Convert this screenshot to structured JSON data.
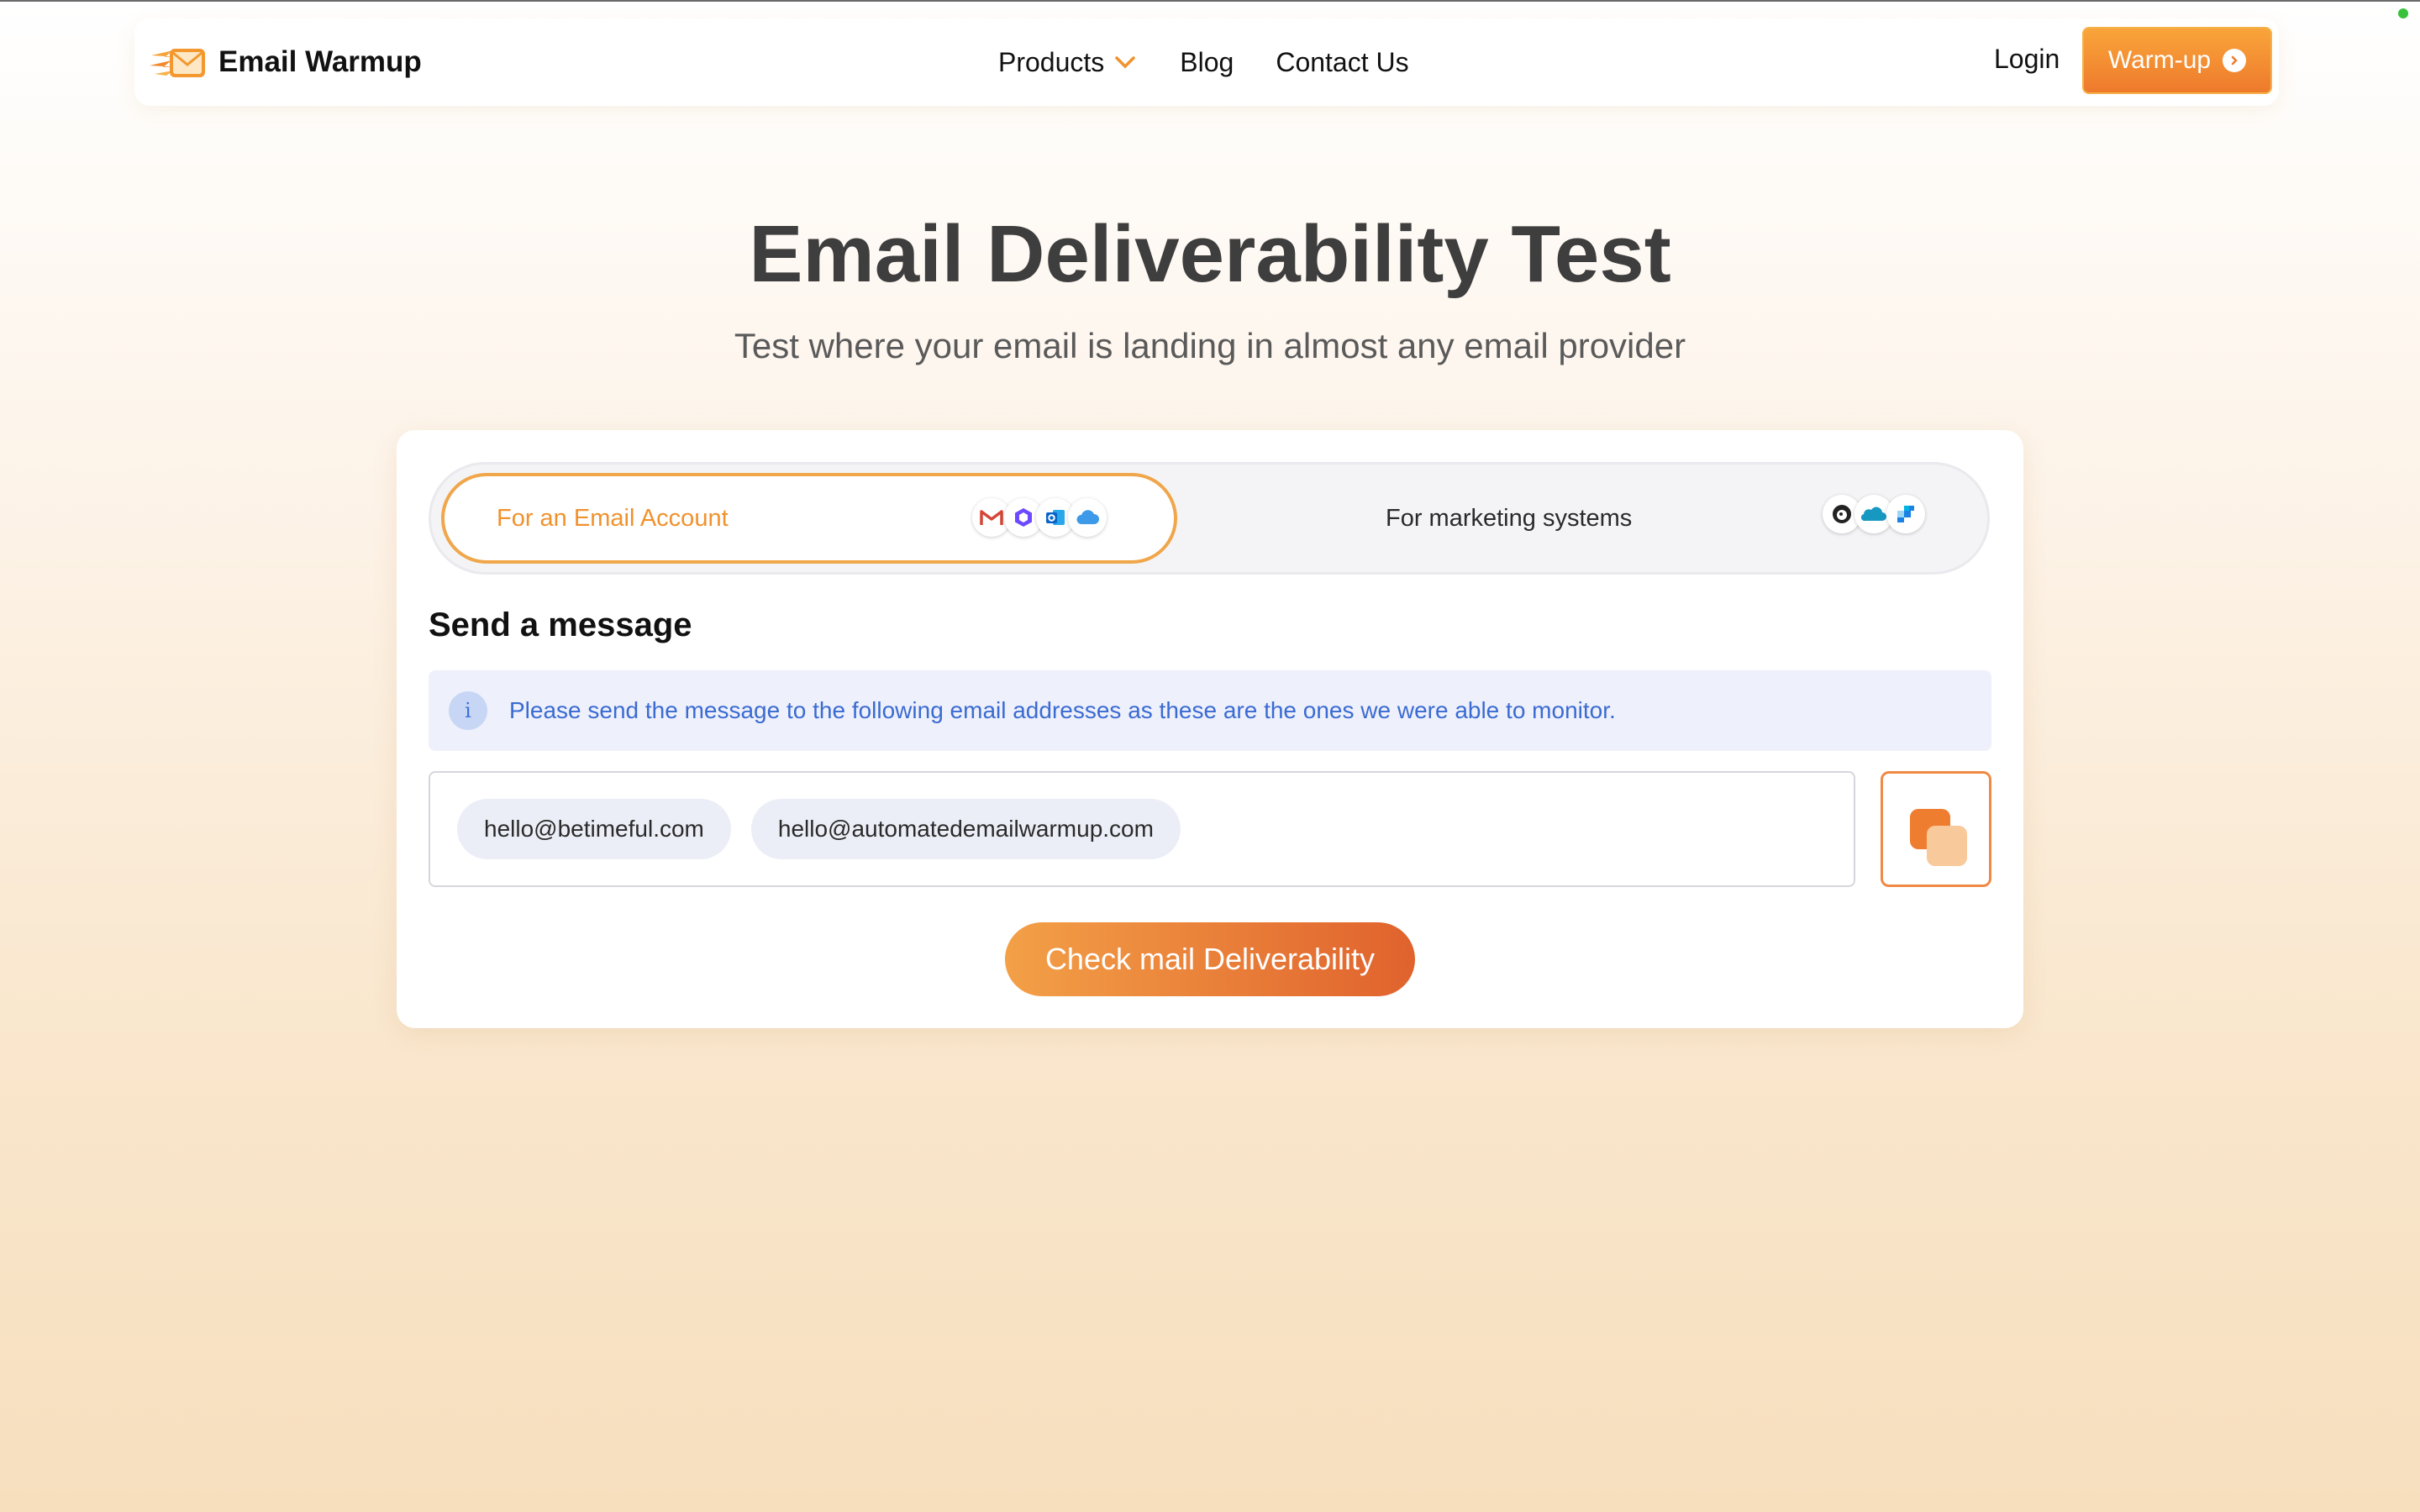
{
  "brand": {
    "name": "Email Warmup"
  },
  "nav": {
    "items": [
      {
        "label": "Products",
        "has_dropdown": true
      },
      {
        "label": "Blog"
      },
      {
        "label": "Contact Us"
      }
    ],
    "login": "Login",
    "cta": "Warm-up"
  },
  "hero": {
    "title": "Email Deliverability Test",
    "subtitle": "Test where your email is landing in almost any email provider"
  },
  "tabs": [
    {
      "label": "For an Email Account",
      "active": true,
      "icons": [
        "gmail-icon",
        "proton-icon",
        "outlook-icon",
        "icloud-icon"
      ]
    },
    {
      "label": "For marketing systems",
      "active": false,
      "icons": [
        "mailchimp-icon",
        "salesforce-icon",
        "sendgrid-icon"
      ]
    }
  ],
  "send": {
    "title": "Send a message",
    "info": "Please send the message to the following email addresses as these are the ones we were able to monitor.",
    "emails": [
      "hello@betimeful.com",
      "hello@automatedemailwarmup.com"
    ],
    "button": "Check mail Deliverability"
  },
  "colors": {
    "accent": "#F0922E",
    "accent_dark": "#E0622D",
    "info_text": "#3A6BD2"
  }
}
